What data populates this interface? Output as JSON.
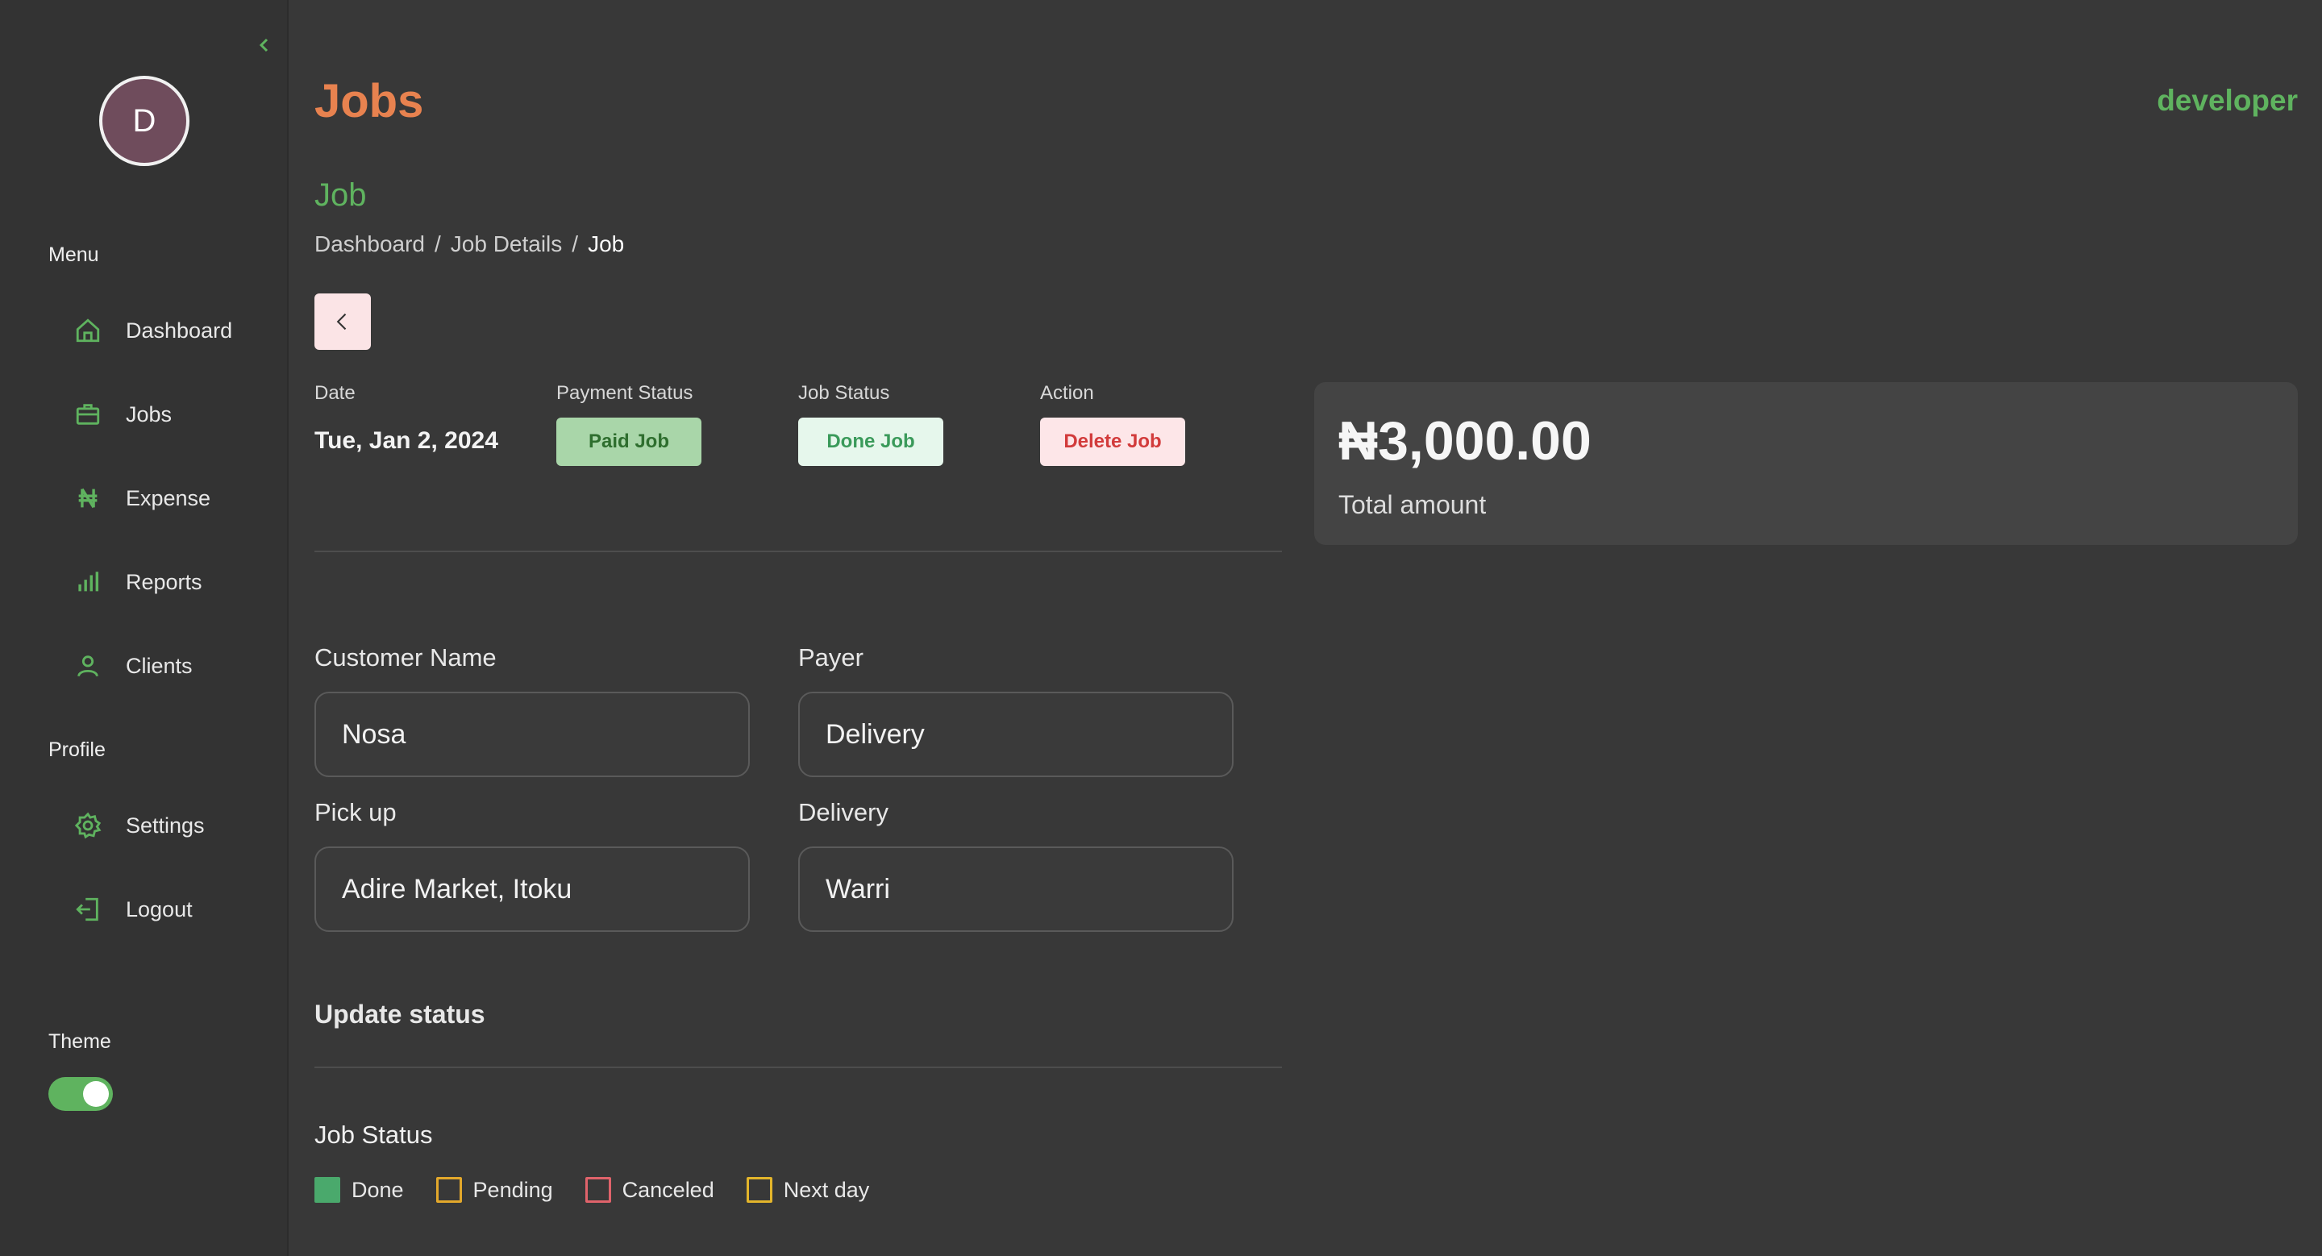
{
  "sidebar": {
    "avatar_initial": "D",
    "menu_label": "Menu",
    "profile_label": "Profile",
    "theme_label": "Theme",
    "menu_items": [
      {
        "label": "Dashboard",
        "icon": "home-icon"
      },
      {
        "label": "Jobs",
        "icon": "briefcase-icon"
      },
      {
        "label": "Expense",
        "icon": "naira-icon"
      },
      {
        "label": "Reports",
        "icon": "bar-chart-icon"
      },
      {
        "label": "Clients",
        "icon": "user-icon"
      }
    ],
    "profile_items": [
      {
        "label": "Settings",
        "icon": "gear-icon"
      },
      {
        "label": "Logout",
        "icon": "logout-icon"
      }
    ],
    "theme_toggle_on": true
  },
  "header": {
    "title": "Jobs",
    "role": "developer"
  },
  "page": {
    "subtitle": "Job",
    "breadcrumb": [
      "Dashboard",
      "Job Details",
      "Job"
    ]
  },
  "info": {
    "date_label": "Date",
    "date_value": "Tue, Jan 2, 2024",
    "payment_label": "Payment Status",
    "payment_value": "Paid Job",
    "job_status_label": "Job Status",
    "job_status_value": "Done Job",
    "action_label": "Action",
    "action_value": "Delete Job"
  },
  "total": {
    "amount": "₦3,000.00",
    "label": "Total amount"
  },
  "form": {
    "customer_label": "Customer Name",
    "customer_value": "Nosa",
    "payer_label": "Payer",
    "payer_value": "Delivery",
    "pickup_label": "Pick up",
    "pickup_value": "Adire Market, Itoku",
    "delivery_label": "Delivery",
    "delivery_value": "Warri"
  },
  "update": {
    "title": "Update status",
    "job_status_title": "Job Status",
    "options": [
      {
        "label": "Done",
        "checked": true,
        "color": "#4aa96c"
      },
      {
        "label": "Pending",
        "checked": false,
        "color": "#e3a82b"
      },
      {
        "label": "Canceled",
        "checked": false,
        "color": "#e0636b"
      },
      {
        "label": "Next day",
        "checked": false,
        "color": "#e3b52b"
      }
    ]
  },
  "colors": {
    "accent_green": "#5fb35f",
    "title_orange": "#e8824f"
  }
}
